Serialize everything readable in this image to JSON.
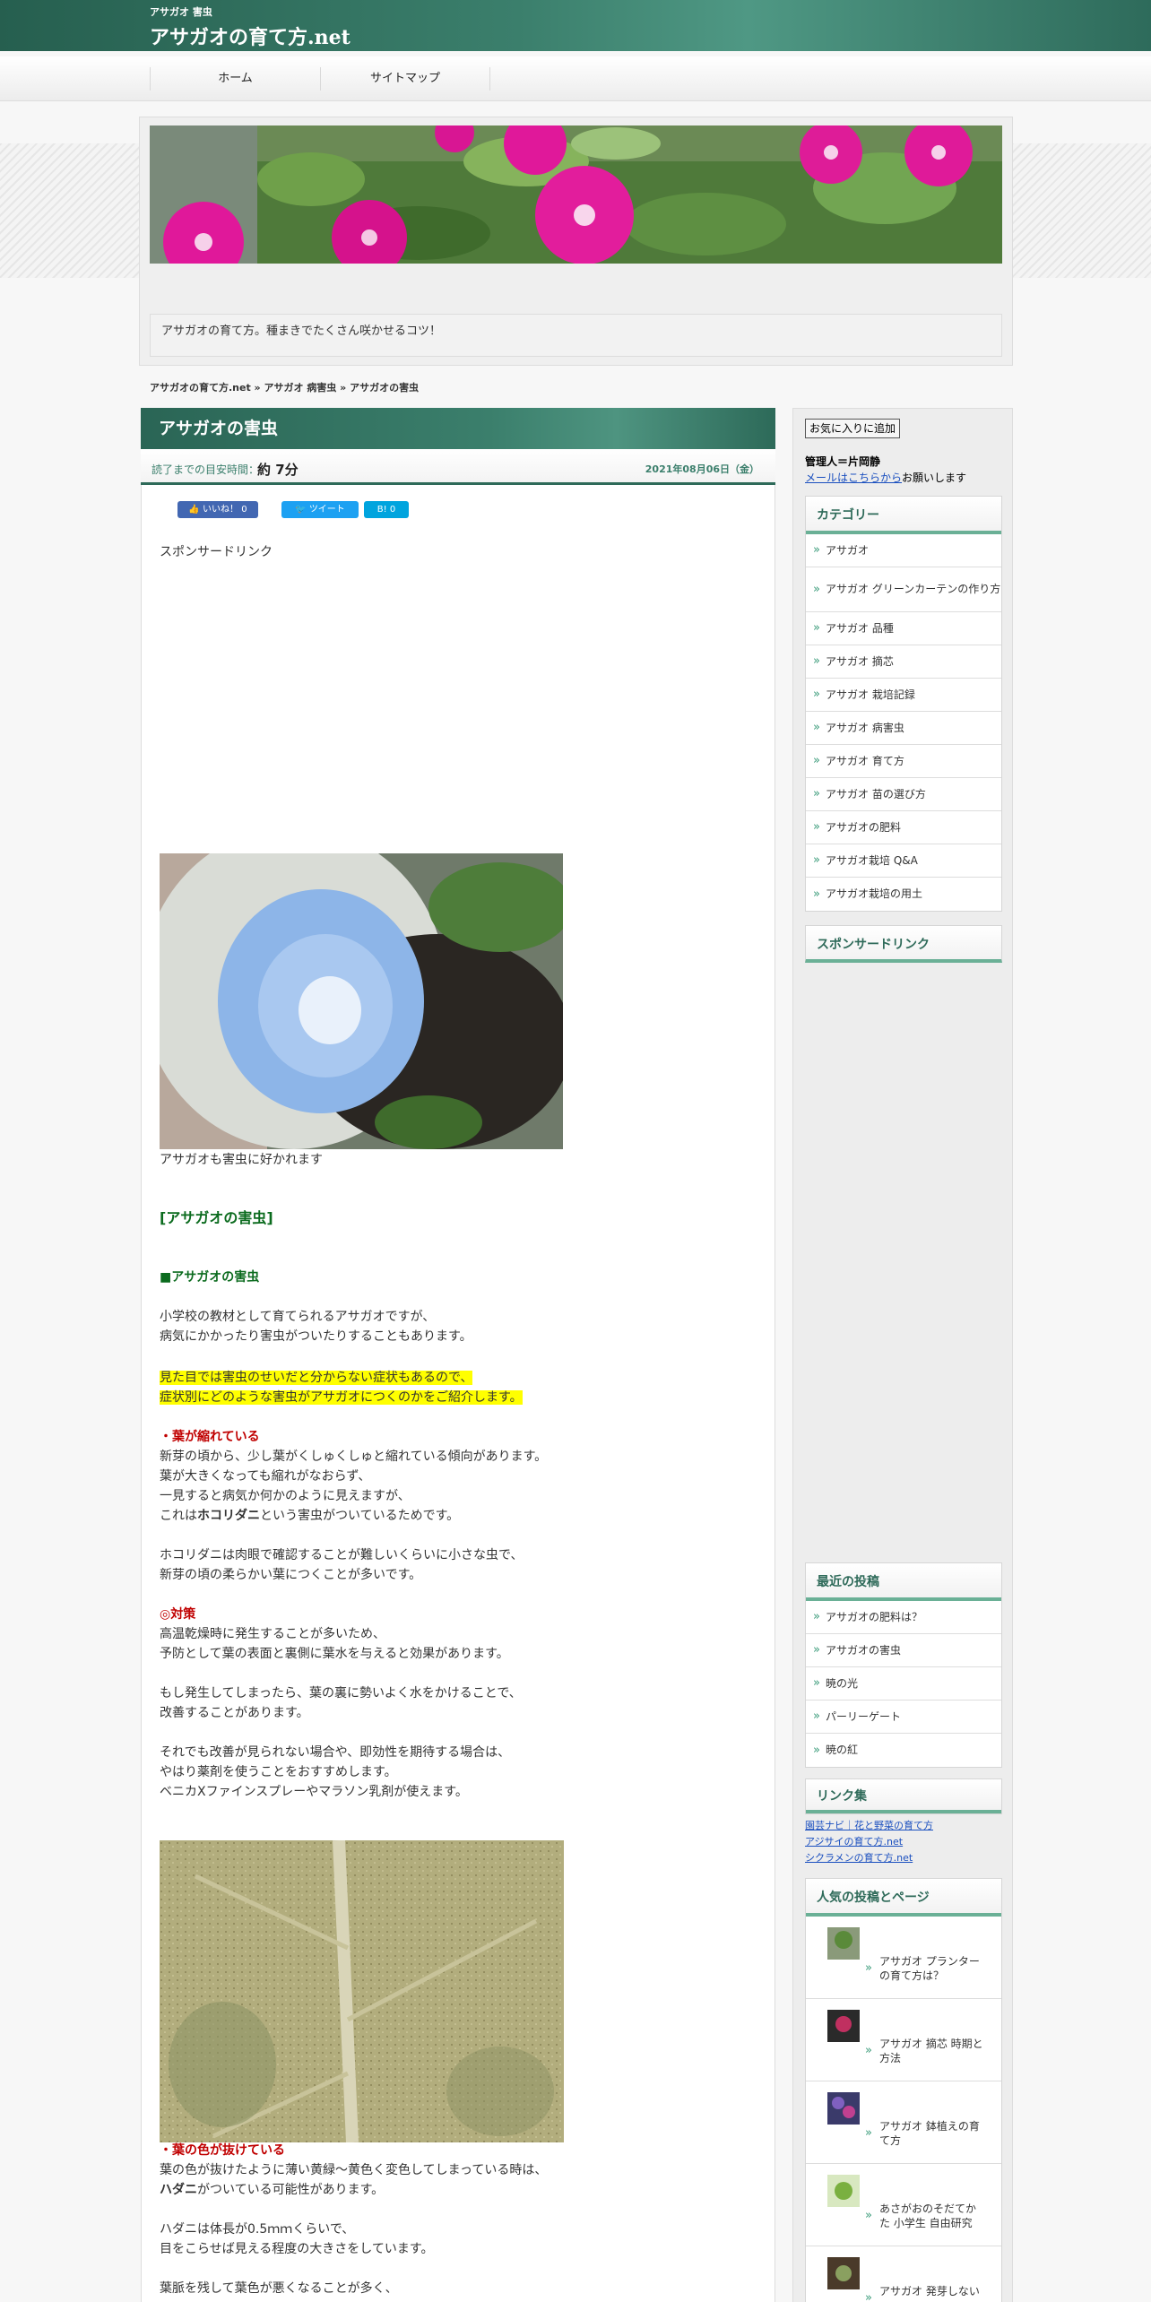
{
  "header": {
    "tagline": "アサガオ 害虫",
    "site_title": "アサガオの育て方.net"
  },
  "nav": {
    "items": [
      "ホーム",
      "サイトマップ"
    ]
  },
  "hero": {
    "caption": "アサガオの育て方。種まきでたくさん咲かせるコツ！"
  },
  "breadcrumb": "アサガオの育て方.net » アサガオ 病害虫 » アサガオの害虫",
  "article": {
    "title": "アサガオの害虫",
    "read_label": "読了までの目安時間：",
    "read_value": "約 7分",
    "date": "2021年08月06日（金）",
    "social": {
      "like": "いいね！ 0",
      "tweet": "ツイート",
      "hatena": "B! 0"
    },
    "sponsored": "スポンサードリンク",
    "photo1_caption": "アサガオも害虫に好かれます",
    "heading": "[アサガオの害虫]",
    "subheading": "■アサガオの害虫",
    "intro1": "小学校の教材として育てられるアサガオですが、",
    "intro2": "病気にかかったり害虫がついたりすることもあります。",
    "hl1": "見た目では害虫のせいだと分からない症状もあるので、",
    "hl2": "症状別にどのような害虫がアサガオにつくのかをご紹介します。",
    "s1_title": "・葉が縮れている",
    "s1_l1": "新芽の頃から、少し葉がくしゅくしゅと縮れている傾向があります。",
    "s1_l2": "葉が大きくなっても縮れがなおらず、",
    "s1_l3": "一見すると病気か何かのように見えますが、",
    "s1_l4a": "これは",
    "s1_l4b": "ホコリダニ",
    "s1_l4c": "という害虫がついているためです。",
    "s1_l5": "ホコリダニは肉眼で確認することが難しいくらいに小さな虫で、",
    "s1_l6": "新芽の頃の柔らかい葉につくことが多いです。",
    "taisaku": "◎対策",
    "t_l1": "高温乾燥時に発生することが多いため、",
    "t_l2": "予防として葉の表面と裏側に葉水を与えると効果があります。",
    "t_l3": "もし発生してしまったら、葉の裏に勢いよく水をかけることで、",
    "t_l4": "改善することがあります。",
    "t_l5": "それでも改善が見られない場合や、即効性を期待する場合は、",
    "t_l6": "やはり薬剤を使うことをおすすめします。",
    "t_l7": "ベニカXファインスプレーやマラソン乳剤が使えます。",
    "s2_title": "・葉の色が抜けている",
    "s2_l1": "葉の色が抜けたように薄い黄緑～黄色く変色してしまっている時は、",
    "s2_l2a": "ハダニ",
    "s2_l2b": "がついている可能性があります。",
    "s2_l3": "ハダニは体長が0.5ｍｍくらいで、",
    "s2_l4": "目をこらせば見える程度の大きさをしています。",
    "s2_l5": "葉脈を残して葉色が悪くなることが多く、"
  },
  "sidebar": {
    "fav_button": "お気に入りに追加",
    "admin": "管理人＝片岡静",
    "mail_link": "メールはこちらから",
    "mail_suffix": "お願いします",
    "category_title": "カテゴリー",
    "categories": [
      "アサガオ",
      "アサガオ グリーンカーテンの作り方",
      "アサガオ 品種",
      "アサガオ 摘芯",
      "アサガオ 栽培記録",
      "アサガオ 病害虫",
      "アサガオ 育て方",
      "アサガオ 苗の選び方",
      "アサガオの肥料",
      "アサガオ栽培 Q&A",
      "アサガオ栽培の用土"
    ],
    "sponsored_title": "スポンサードリンク",
    "recent_title": "最近の投稿",
    "recent": [
      "アサガオの肥料は？",
      "アサガオの害虫",
      "暁の光",
      "パーリーゲート",
      "暁の紅"
    ],
    "links_title": "リンク集",
    "links": [
      "園芸ナビ｜花と野菜の育て方",
      "アジサイの育て方.net",
      "シクラメンの育て方.net"
    ],
    "popular_title": "人気の投稿とページ",
    "popular": [
      "アサガオ プランターの育て方は？",
      "アサガオ 摘芯 時期と方法",
      "アサガオ 鉢植えの育て方",
      "あさがおのそだてかた 小学生 自由研究",
      "アサガオ 発芽しない"
    ]
  },
  "colors": {
    "brand": "#2e6a59",
    "accent": "#6ab096",
    "highlight": "#ffff00",
    "warning": "#c00000",
    "heading_green": "#0b6b1e"
  }
}
